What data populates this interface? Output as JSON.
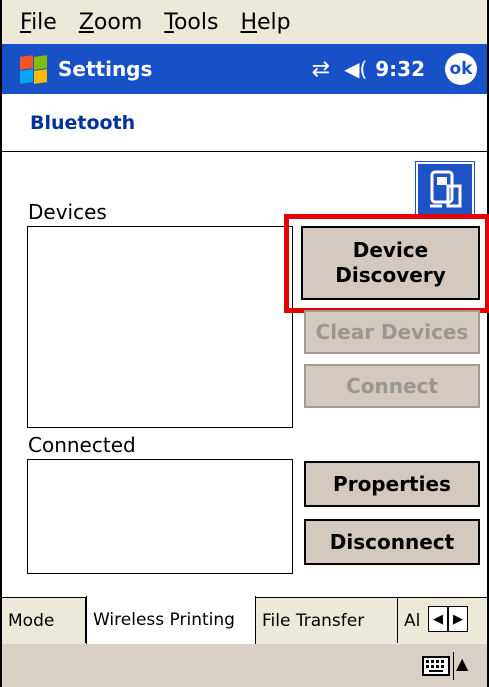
{
  "menu": {
    "items": [
      {
        "label": "File",
        "ul": "F",
        "rest": "ile"
      },
      {
        "label": "Zoom",
        "ul": "Z",
        "rest": "oom"
      },
      {
        "label": "Tools",
        "ul": "T",
        "rest": "ools"
      },
      {
        "label": "Help",
        "ul": "H",
        "rest": "elp"
      }
    ]
  },
  "titlebar": {
    "title": "Settings",
    "clock": "9:32",
    "ok_label": "ok",
    "connectivity_icon": "connectivity-icon",
    "volume_icon": "speaker-icon"
  },
  "subheader": {
    "title": "Bluetooth"
  },
  "devices": {
    "label": "Devices",
    "discovery_button_line1": "Device",
    "discovery_button_line2": "Discovery",
    "clear_button": "Clear Devices",
    "connect_button": "Connect"
  },
  "connected": {
    "label": "Connected",
    "properties_button": "Properties",
    "disconnect_button": "Disconnect"
  },
  "tabs": [
    {
      "label": "Mode",
      "active": false
    },
    {
      "label": "Wireless Printing",
      "active": true
    },
    {
      "label": "File Transfer",
      "active": false
    },
    {
      "label": "Al",
      "active": false
    }
  ],
  "colors": {
    "titlebar": "#1750c7",
    "highlight": "#e30000",
    "button_face": "#d4c9be",
    "subheader_text": "#003399"
  }
}
